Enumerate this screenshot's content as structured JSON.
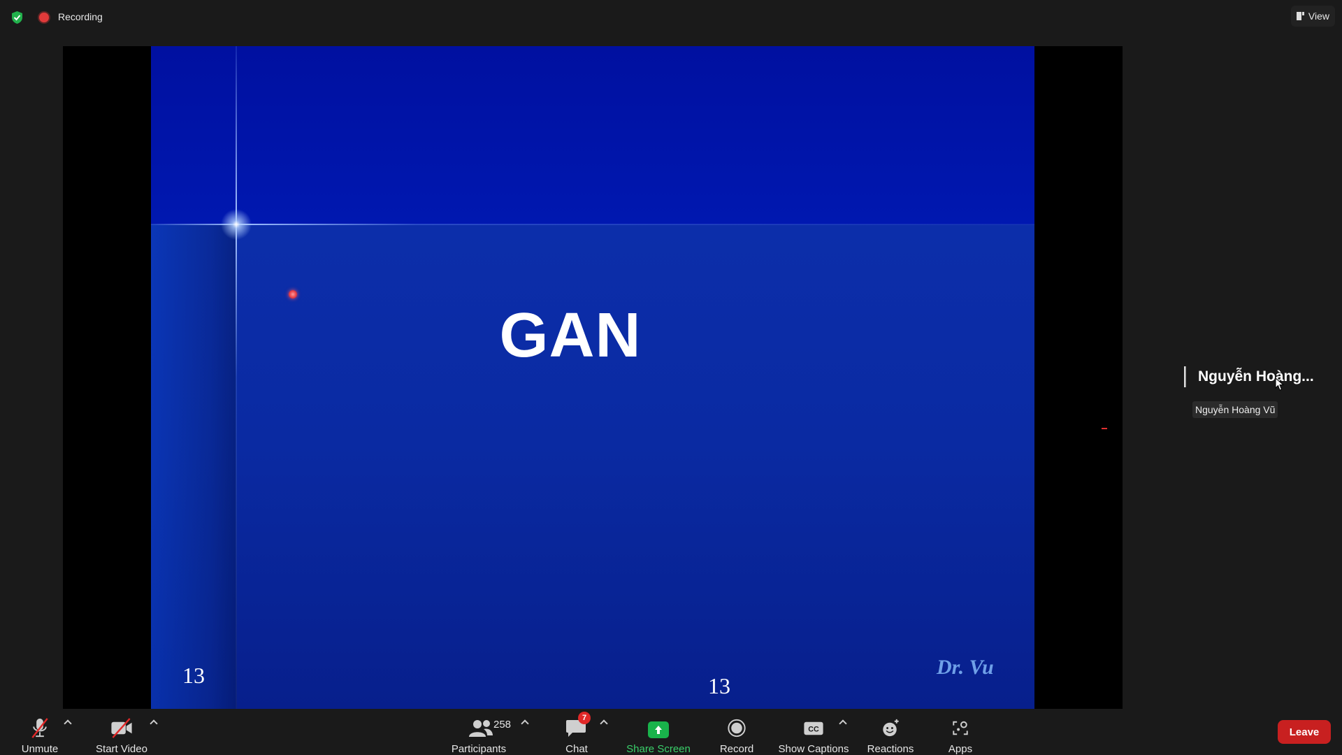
{
  "top_bar": {
    "recording_label": "Recording",
    "view_label": "View"
  },
  "slide": {
    "title": "GAN",
    "page_number_left": "13",
    "page_number_center": "13",
    "signature": "Dr. Vu"
  },
  "participant_tile": {
    "display_name": "Nguyễn Hoàng...",
    "tooltip": "Nguyễn Hoàng Vũ"
  },
  "toolbar": {
    "unmute_label": "Unmute",
    "start_video_label": "Start Video",
    "participants_label": "Participants",
    "participants_count": "258",
    "chat_label": "Chat",
    "chat_badge": "7",
    "share_screen_label": "Share Screen",
    "record_label": "Record",
    "show_captions_label": "Show Captions",
    "reactions_label": "Reactions",
    "apps_label": "Apps",
    "leave_label": "Leave"
  },
  "colors": {
    "share_green": "#19b34b",
    "leave_red": "#c82020",
    "badge_red": "#e02828",
    "slide_blue": "#0a2aa2"
  }
}
